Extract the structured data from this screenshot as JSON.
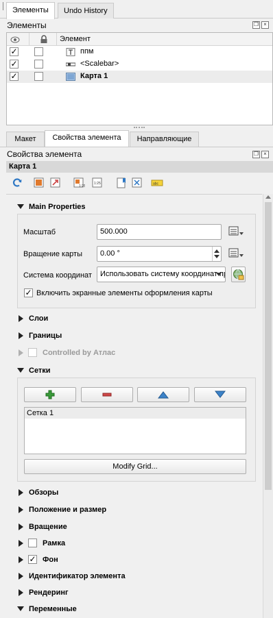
{
  "top_tabs": [
    "Элементы",
    "Undo History"
  ],
  "items_panel": {
    "title": "Элементы",
    "column_header": "Элемент",
    "rows": [
      {
        "visible": true,
        "locked": false,
        "icon": "text-icon",
        "label": "ппм",
        "bold": false,
        "selected": false
      },
      {
        "visible": true,
        "locked": false,
        "icon": "scalebar-icon",
        "label": "<Scalebar>",
        "bold": false,
        "selected": false
      },
      {
        "visible": true,
        "locked": false,
        "icon": "map-icon",
        "label": "Карта 1",
        "bold": true,
        "selected": true
      }
    ]
  },
  "prop_tabs": [
    "Макет",
    "Свойства элемента",
    "Направляющие"
  ],
  "props_panel": {
    "title": "Свойства элемента",
    "item_name": "Карта 1"
  },
  "main_properties": {
    "title": "Main Properties",
    "scale_label": "Масштаб",
    "scale_value": "500.000",
    "rotation_label": "Вращение карты",
    "rotation_value": "0.00 °",
    "crs_label": "Система координат",
    "crs_value": "Использовать систему координат проекта",
    "draw_canvas_label": "Включить экранные элементы оформления карты",
    "draw_canvas_checked": true
  },
  "sections_a": [
    "Слои",
    "Границы"
  ],
  "atlas": {
    "label": "Controlled by Атлас",
    "checked": false
  },
  "grids": {
    "title": "Сетки",
    "list": [
      "Сетка 1"
    ],
    "modify_label": "Modify Grid..."
  },
  "sections_b": [
    {
      "label": "Обзоры",
      "checkbox": null
    },
    {
      "label": "Положение и размер",
      "checkbox": null
    },
    {
      "label": "Вращение",
      "checkbox": null
    },
    {
      "label": "Рамка",
      "checkbox": false
    },
    {
      "label": "Фон",
      "checkbox": true
    },
    {
      "label": "Идентификатор элемента",
      "checkbox": null
    },
    {
      "label": "Рендеринг",
      "checkbox": null
    },
    {
      "label": "Переменные",
      "checkbox": null,
      "expanded": true
    }
  ],
  "colors": {
    "accent_blue": "#3c82c8",
    "add_green": "#3a9b3a",
    "remove_red": "#d04848"
  }
}
